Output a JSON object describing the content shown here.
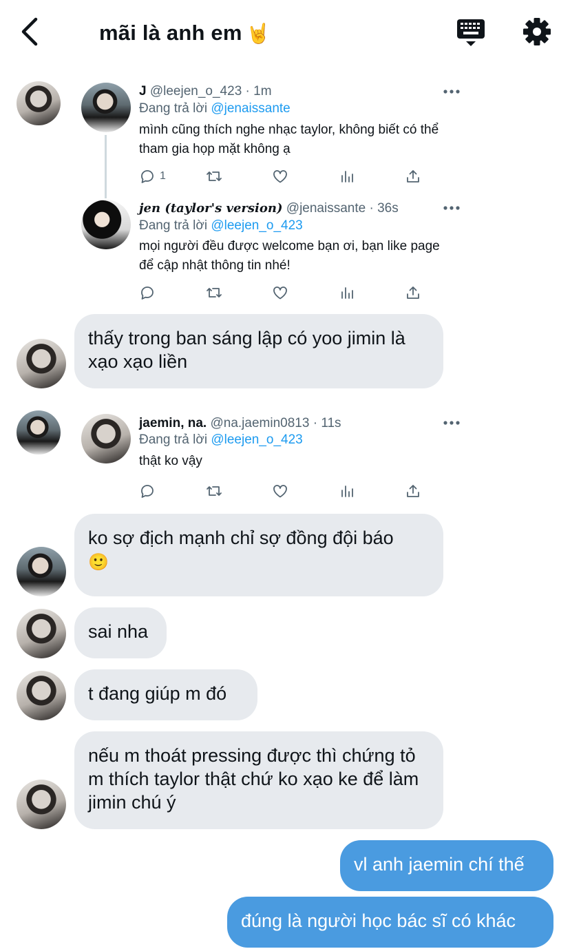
{
  "header": {
    "title": "mãi là anh em",
    "title_emoji": "🤘"
  },
  "tweets": [
    {
      "name": "J",
      "handle": "@leejen_o_423",
      "time": "· 1m",
      "reply_prefix": "Đang trả lời",
      "reply_to": "@jenaissante",
      "text": "mình cũng thích nghe nhạc taylor, không biết có thể tham gia họp mặt không ạ",
      "reply_count": "1"
    },
    {
      "name": "jen (taylor's version)",
      "handle": "@jenaissante",
      "time": "· 36s",
      "reply_prefix": "Đang trả lời",
      "reply_to": "@leejen_o_423",
      "text": "mọi người đều được welcome bạn ơi, bạn like page để cập nhật thông tin nhé!"
    },
    {
      "name": "jaemin, na.",
      "handle": "@na.jaemin0813",
      "time": "· 11s",
      "reply_prefix": "Đang trả lời",
      "reply_to": "@leejen_o_423",
      "text": "thật ko vậy"
    }
  ],
  "messages": [
    {
      "text": "thấy trong ban sáng lập có yoo jimin là xạo xạo liền"
    },
    {
      "text": "ko sợ địch mạnh chỉ sợ đồng đội báo",
      "emoji": "🙂"
    },
    {
      "text": "sai nha"
    },
    {
      "text": "t đang giúp m đó"
    },
    {
      "text": "nếu m thoát pressing được thì chứng tỏ m thích taylor thật chứ ko xạo ke để làm jimin chú ý"
    },
    {
      "text": "vl anh jaemin chí thế"
    },
    {
      "text": "đúng là người học bác sĩ có khác"
    }
  ],
  "colors": {
    "accent": "#1d9bf0",
    "my_bubble": "#4a9be0",
    "their_bubble": "#e7eaee",
    "secondary_text": "#536471"
  },
  "icons": [
    "back-arrow-icon",
    "keyboard-icon",
    "gear-icon",
    "reply-icon",
    "retweet-icon",
    "like-icon",
    "stats-icon",
    "share-icon",
    "more-icon"
  ]
}
